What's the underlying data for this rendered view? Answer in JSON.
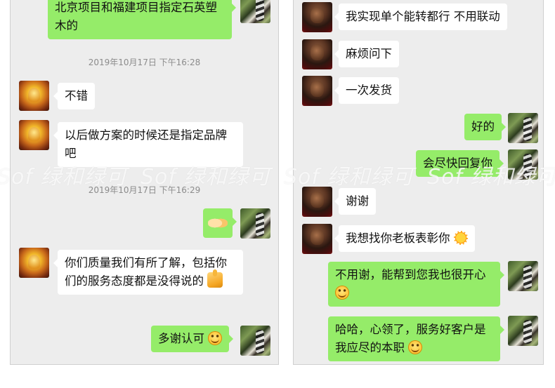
{
  "left_panel": {
    "messages": [
      {
        "type": "out",
        "text": "北京项目和福建项目指定石英塑木的"
      },
      {
        "type": "timestamp",
        "text": "2019年10月17日 下午16:28"
      },
      {
        "type": "in",
        "text": "不错"
      },
      {
        "type": "in",
        "text": "以后做方案的时候还是指定品牌吧"
      },
      {
        "type": "timestamp",
        "text": "2019年10月17日 下午16:29"
      },
      {
        "type": "out",
        "emoji": "handshake-emoji"
      },
      {
        "type": "in",
        "text": "你们质量我们有所了解，包括你们的服务态度都是没得说的",
        "emoji": "thumbs-up-emoji"
      },
      {
        "type": "out",
        "text": "多谢认可",
        "emoji": "smile-emoji"
      }
    ]
  },
  "right_panel": {
    "messages": [
      {
        "type": "in",
        "text": "我实现单个能转都行 不用联动"
      },
      {
        "type": "in",
        "text": "麻烦问下"
      },
      {
        "type": "in",
        "text": "一次发货"
      },
      {
        "type": "out",
        "text": "好的"
      },
      {
        "type": "out",
        "text": "会尽快回复你"
      },
      {
        "type": "in",
        "text": "谢谢"
      },
      {
        "type": "in",
        "text": "我想找你老板表彰你",
        "emoji": "sun-emoji"
      },
      {
        "type": "out",
        "text": "不用谢，能帮到您我也很开心",
        "emoji": "smile-emoji"
      },
      {
        "type": "out",
        "text": "哈哈，心领了，服务好客户是我应尽的本职",
        "emoji": "smile-emoji"
      }
    ]
  },
  "watermark": {
    "text": "Sof 绿和绿可"
  },
  "colors": {
    "outgoing_bubble": "#95ec69",
    "incoming_bubble": "#ffffff",
    "chat_background": "#ededed"
  },
  "avatars": {
    "contact_left": "buddha-avatar",
    "contact_right": "man-avatar",
    "self": "woman-avatar"
  }
}
